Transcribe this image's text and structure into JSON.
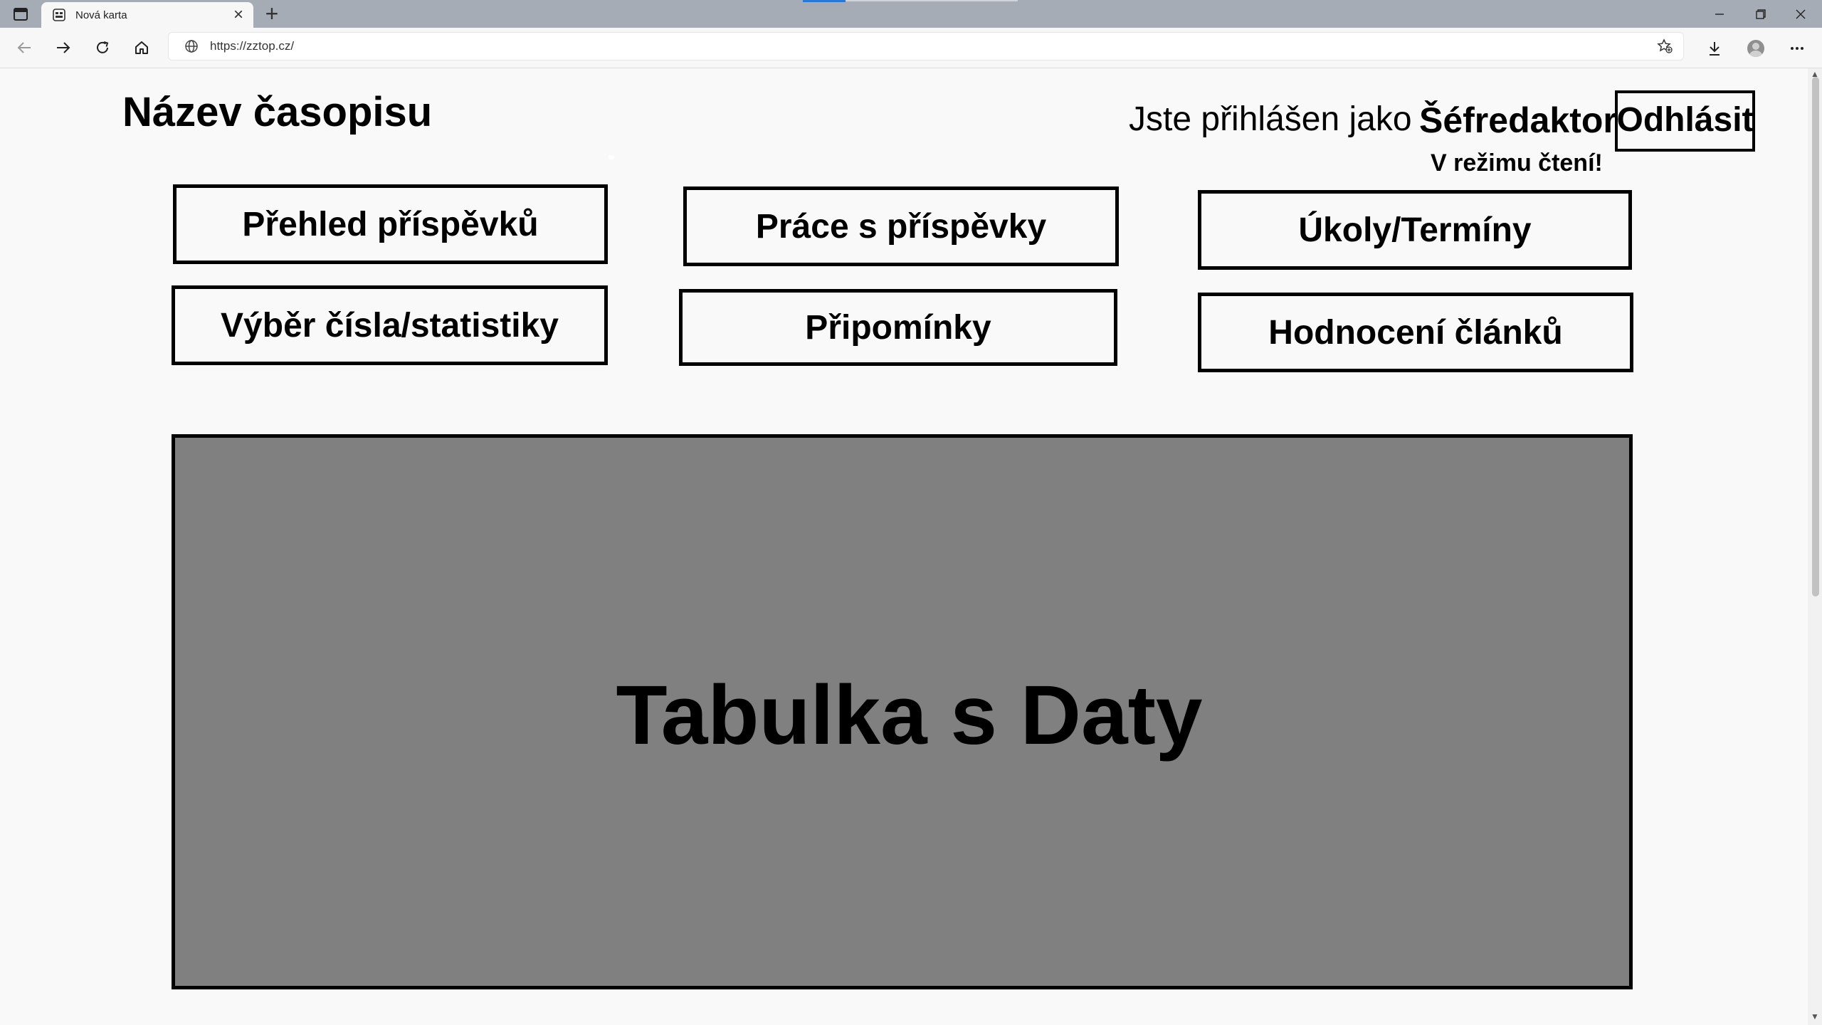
{
  "browser": {
    "tab_title": "Nová karta",
    "new_tab_symbol": "+",
    "close_symbol": "×",
    "url": "https://zztop.cz/"
  },
  "header": {
    "journal_title": "Název časopisu",
    "login_text": "Jste přihlášen jako",
    "login_role": "Šéfredaktor",
    "logout_label": "Odhlásit",
    "mode_text": "V režimu čtení!"
  },
  "nav": {
    "overview": "Přehled příspěvků",
    "work": "Práce s příspěvky",
    "tasks": "Úkoly/Termíny",
    "issue_stats": "Výběr čísla/statistiky",
    "comments": "Připomínky",
    "rating": "Hodnocení článků"
  },
  "main": {
    "data_panel_label": "Tabulka s Daty",
    "panel_color": "#808080"
  }
}
